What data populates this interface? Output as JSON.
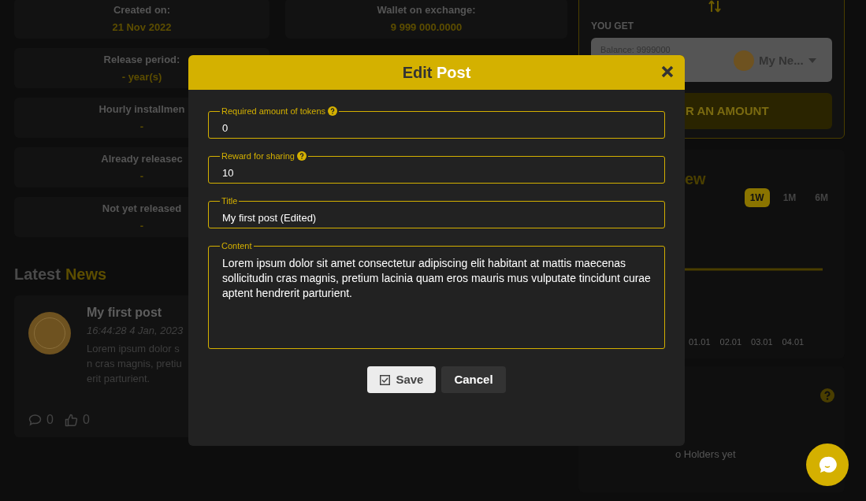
{
  "stats": [
    {
      "label": "Created on:",
      "value": "21 Nov 2022"
    },
    {
      "label": "Wallet on exchange:",
      "value": "9 999 000.0000"
    },
    {
      "label": "Release period:",
      "value": "- year(s)"
    },
    {
      "label": "Hourly installmen",
      "value": "-"
    },
    {
      "label": "Already releasec",
      "value": "-"
    },
    {
      "label": "Not yet released",
      "value": "-"
    }
  ],
  "news": {
    "heading": [
      "Latest",
      "News"
    ],
    "post": {
      "title": "My first post",
      "time": "16:44:28 4 Jan, 2023",
      "excerpt_lines": [
        "Lorem ipsum dolor s",
        "n cras magnis, pretiu",
        "erit parturient."
      ],
      "comments": "0",
      "likes": "0"
    }
  },
  "swap": {
    "label": "YOU GET",
    "balance": "Balance: 9999000",
    "token": "My Ne...",
    "button": "R AN AMOUNT"
  },
  "chart": {
    "title": "ew",
    "ranges": [
      {
        "label": "1W",
        "selected": true
      },
      {
        "label": "1M",
        "selected": false
      },
      {
        "label": "6M",
        "selected": false
      }
    ],
    "x_labels": [
      "01.01",
      "02.01",
      "03.01",
      "04.01"
    ]
  },
  "holders": {
    "empty_text": "o Holders yet"
  },
  "modal": {
    "title": [
      "Edit",
      "Post"
    ],
    "fields": [
      {
        "kind": "input",
        "label": "Required amount of tokens",
        "help": true,
        "value": "0"
      },
      {
        "kind": "input",
        "label": "Reward for sharing",
        "help": true,
        "value": "10"
      },
      {
        "kind": "input",
        "label": "Title",
        "help": false,
        "value": "My first post (Edited)"
      },
      {
        "kind": "textarea",
        "label": "Content",
        "help": false,
        "value": "Lorem ipsum dolor sit amet consectetur adipiscing elit habitant at mattis maecenas sollicitudin cras magnis, pretium lacinia quam eros mauris mus vulputate tincidunt curae aptent hendrerit parturient."
      }
    ],
    "buttons": [
      {
        "kind": "save",
        "label": "Save"
      },
      {
        "kind": "cancel",
        "label": "Cancel"
      }
    ]
  }
}
